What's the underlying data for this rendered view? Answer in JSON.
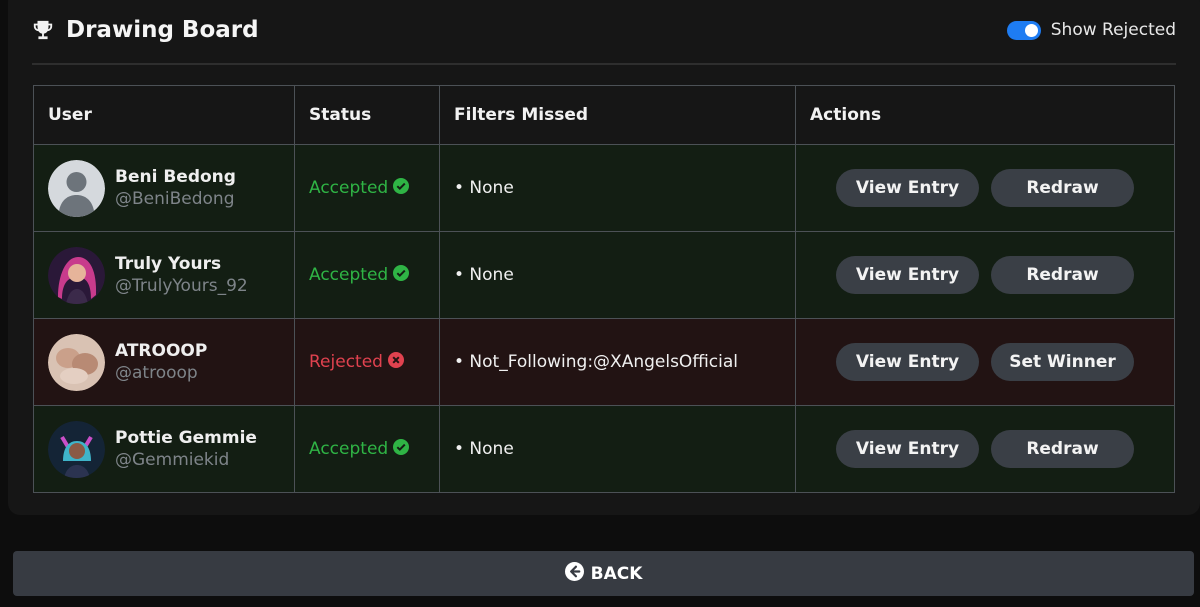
{
  "header": {
    "title": "Drawing Board",
    "title_icon": "trophy-icon",
    "toggle_label": "Show Rejected",
    "toggle_on": true,
    "toggle_color": "#1e7cf2"
  },
  "table": {
    "columns": [
      "User",
      "Status",
      "Filters Missed",
      "Actions"
    ],
    "rows": [
      {
        "name": "Beni Bedong",
        "handle": "@BeniBedong",
        "status": "Accepted",
        "filter": "• None",
        "view_label": "View Entry",
        "action_label": "Redraw"
      },
      {
        "name": "Truly Yours",
        "handle": "@TrulyYours_92",
        "status": "Accepted",
        "filter": "• None",
        "view_label": "View Entry",
        "action_label": "Redraw"
      },
      {
        "name": "ATROOOP",
        "handle": "@atrooop",
        "status": "Rejected",
        "filter": "• Not_Following:@XAngelsOfficial",
        "view_label": "View Entry",
        "action_label": "Set Winner"
      },
      {
        "name": "Pottie Gemmie",
        "handle": "@Gemmiekid",
        "status": "Accepted",
        "filter": "• None",
        "view_label": "View Entry",
        "action_label": "Redraw"
      }
    ]
  },
  "colors": {
    "accepted": "#2fb445",
    "rejected": "#e0424f",
    "accepted_row_bg": "#131e13",
    "rejected_row_bg": "#221313"
  },
  "footer": {
    "back_label": "BACK",
    "back_icon": "arrow-left-circle-icon"
  }
}
